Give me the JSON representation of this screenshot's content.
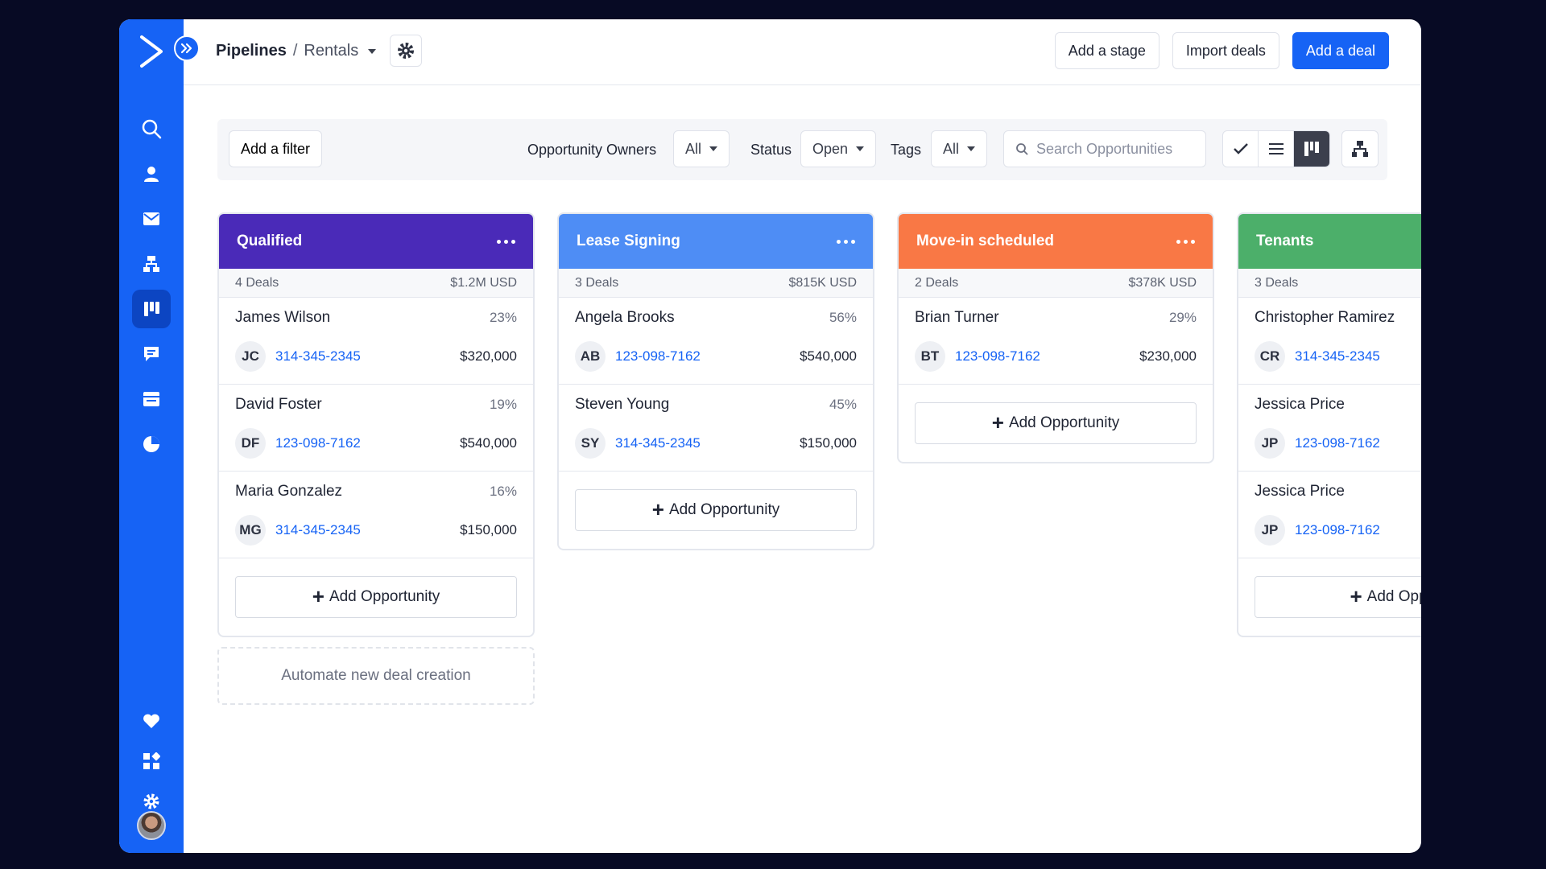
{
  "colors": {
    "brand": "#1663f5",
    "qualified": "#4a2ab8",
    "lease_signing": "#4e8df5",
    "move_in": "#f97845",
    "tenants": "#4caf6a",
    "link": "#1663f5"
  },
  "sidebar": {
    "items": [
      {
        "icon": "search-icon"
      },
      {
        "icon": "contacts-icon"
      },
      {
        "icon": "email-icon"
      },
      {
        "icon": "automations-icon"
      },
      {
        "icon": "deals-pipeline-icon",
        "active": true
      },
      {
        "icon": "conversations-icon"
      },
      {
        "icon": "website-icon"
      },
      {
        "icon": "reports-icon"
      }
    ],
    "bottom_items": [
      {
        "icon": "heart-icon"
      },
      {
        "icon": "apps-icon"
      },
      {
        "icon": "settings-gear-icon"
      }
    ]
  },
  "header": {
    "breadcrumb_root": "Pipelines",
    "breadcrumb_sep": "/",
    "breadcrumb_current": "Rentals",
    "add_stage": "Add a stage",
    "import_deals": "Import deals",
    "add_deal": "Add a deal"
  },
  "filters": {
    "add_filter": "Add a filter",
    "owners_label": "Opportunity Owners",
    "owners_value": "All",
    "status_label": "Status",
    "status_value": "Open",
    "tags_label": "Tags",
    "tags_value": "All",
    "search_placeholder": "Search Opportunities"
  },
  "columns": [
    {
      "title": "Qualified",
      "deals_count": "4 Deals",
      "total": "$1.2M USD",
      "deals": [
        {
          "name": "James Wilson",
          "pct": "23%",
          "initials": "JC",
          "phone": "314-345-2345",
          "amount": "$320,000"
        },
        {
          "name": "David Foster",
          "pct": "19%",
          "initials": "DF",
          "phone": "123-098-7162",
          "amount": "$540,000"
        },
        {
          "name": "Maria Gonzalez",
          "pct": "16%",
          "initials": "MG",
          "phone": "314-345-2345",
          "amount": "$150,000"
        }
      ],
      "add_label": "Add Opportunity",
      "automate": "Automate new deal creation"
    },
    {
      "title": "Lease Signing",
      "deals_count": "3 Deals",
      "total": "$815K USD",
      "deals": [
        {
          "name": "Angela Brooks",
          "pct": "56%",
          "initials": "AB",
          "phone": "123-098-7162",
          "amount": "$540,000"
        },
        {
          "name": "Steven Young",
          "pct": "45%",
          "initials": "SY",
          "phone": "314-345-2345",
          "amount": "$150,000"
        }
      ],
      "add_label": "Add Opportunity"
    },
    {
      "title": "Move-in scheduled",
      "deals_count": "2 Deals",
      "total": "$378K USD",
      "deals": [
        {
          "name": "Brian Turner",
          "pct": "29%",
          "initials": "BT",
          "phone": "123-098-7162",
          "amount": "$230,000"
        }
      ],
      "add_label": "Add Opportunity"
    },
    {
      "title": "Tenants",
      "deals_count": "3 Deals",
      "total": "",
      "deals": [
        {
          "name": "Christopher Ramirez",
          "pct": "",
          "initials": "CR",
          "phone": "314-345-2345",
          "amount": ""
        },
        {
          "name": "Jessica Price",
          "pct": "",
          "initials": "JP",
          "phone": "123-098-7162",
          "amount": ""
        },
        {
          "name": "Jessica Price",
          "pct": "",
          "initials": "JP",
          "phone": "123-098-7162",
          "amount": ""
        }
      ],
      "add_label": "Add Oppor"
    }
  ]
}
